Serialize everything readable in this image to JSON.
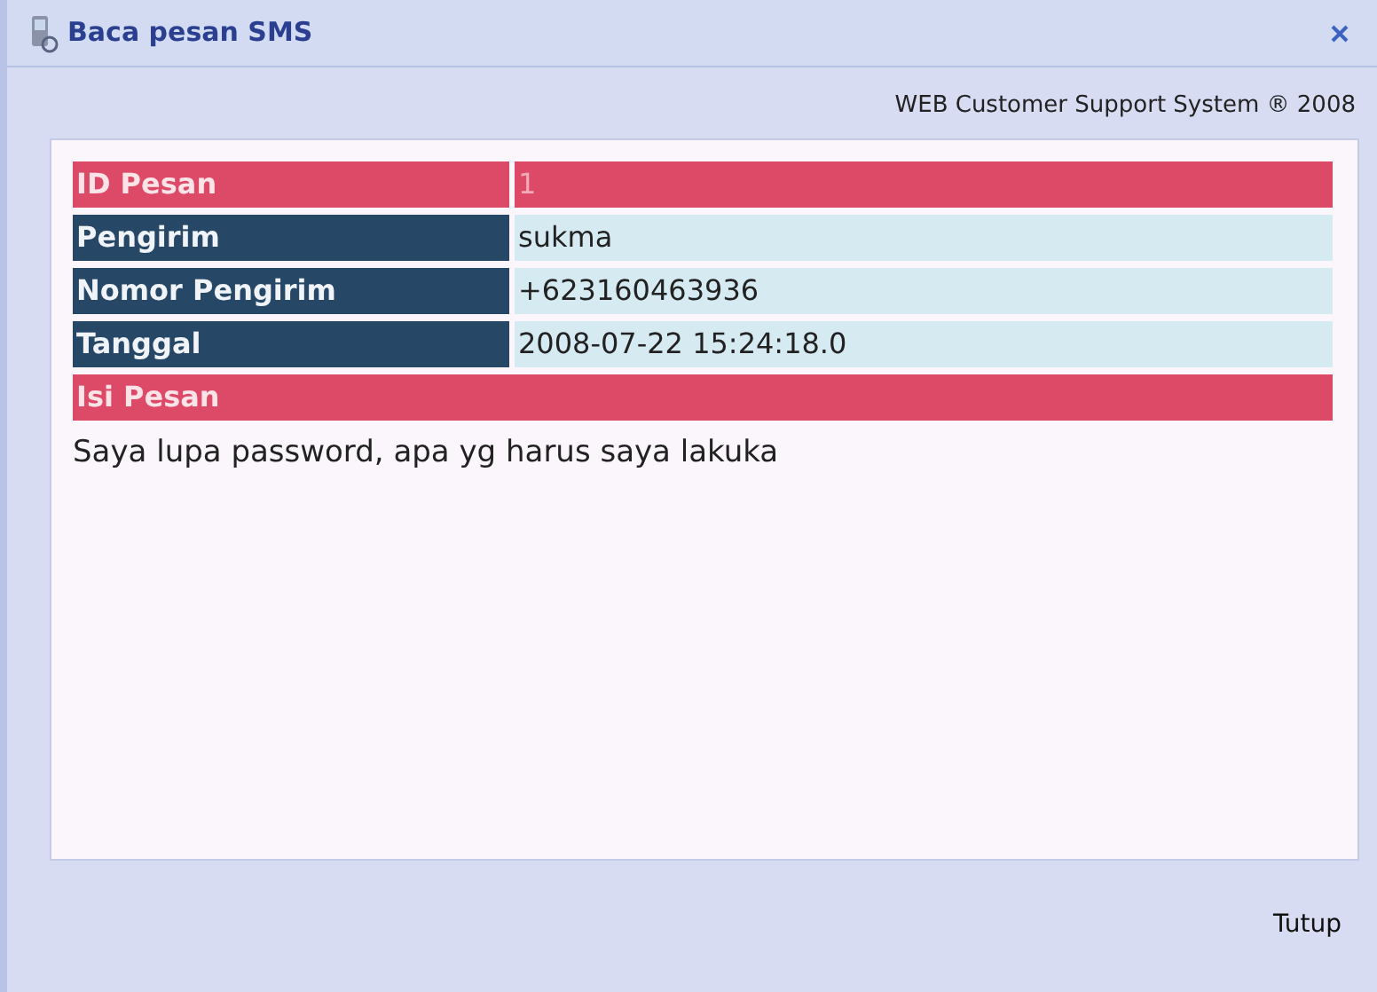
{
  "window": {
    "title": "Baca pesan SMS"
  },
  "header": {
    "text": "WEB Customer Support System ® 2008"
  },
  "rows": [
    {
      "kind": "highlight",
      "label": "ID Pesan",
      "value": "1"
    },
    {
      "kind": "field",
      "label": "Pengirim",
      "value": "sukma"
    },
    {
      "kind": "field",
      "label": "Nomor Pengirim",
      "value": "+623160463936"
    },
    {
      "kind": "field",
      "label": "Tanggal",
      "value": "2008-07-22 15:24:18.0"
    },
    {
      "kind": "section",
      "label": "Isi Pesan"
    }
  ],
  "message": "Saya lupa password, apa yg harus saya lakuka",
  "buttons": [
    "Tutup"
  ]
}
